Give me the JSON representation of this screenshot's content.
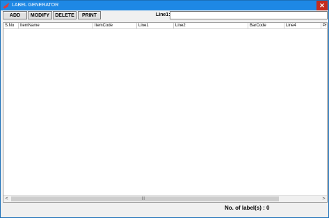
{
  "window": {
    "title": "LABEL GENERATOR",
    "close_glyph": "✕"
  },
  "toolbar": {
    "add_label": "ADD",
    "modify_label": "MODIFY",
    "delete_label": "DELETE",
    "print_label": "PRINT"
  },
  "line1": {
    "label": "Line1:",
    "value": ""
  },
  "grid": {
    "columns": [
      "S.No",
      "ItemName",
      "ItemCode",
      "Line1",
      "Line2",
      "BarCode",
      "Line4",
      "Pr"
    ],
    "rows": []
  },
  "scrollbar": {
    "left_glyph": "<",
    "right_glyph": ">",
    "grip_glyph": "|||"
  },
  "status": {
    "label_count_text": "No. of label(s) : 0"
  }
}
